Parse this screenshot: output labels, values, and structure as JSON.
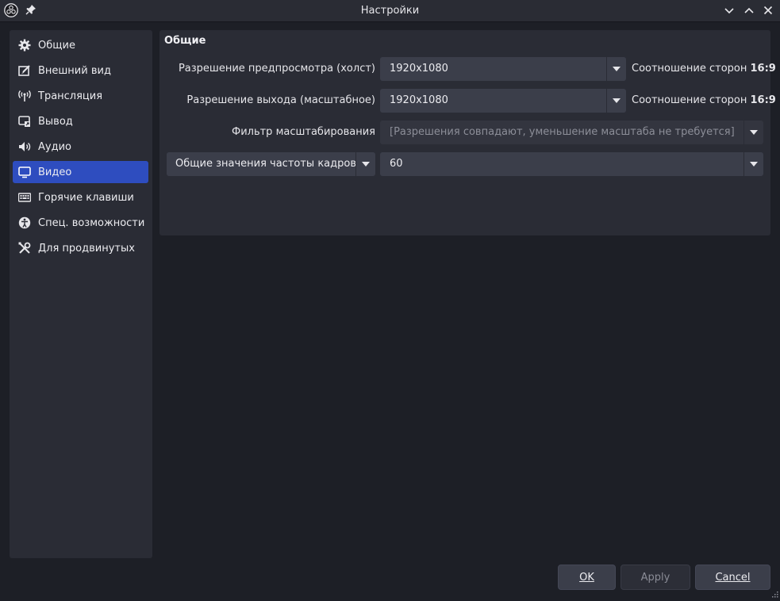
{
  "window": {
    "title": "Настройки"
  },
  "sidebar": {
    "items": [
      {
        "label": "Общие",
        "icon": "gear-icon"
      },
      {
        "label": "Внешний вид",
        "icon": "appearance-icon"
      },
      {
        "label": "Трансляция",
        "icon": "broadcast-icon"
      },
      {
        "label": "Вывод",
        "icon": "output-icon"
      },
      {
        "label": "Аудио",
        "icon": "audio-icon"
      },
      {
        "label": "Видео",
        "icon": "monitor-icon",
        "active": true
      },
      {
        "label": "Горячие клавиши",
        "icon": "keyboard-icon"
      },
      {
        "label": "Спец. возможности",
        "icon": "accessibility-icon"
      },
      {
        "label": "Для продвинутых",
        "icon": "tools-icon"
      }
    ]
  },
  "panel": {
    "section_title": "Общие",
    "base_resolution": {
      "label": "Разрешение предпросмотра (холст)",
      "value": "1920x1080",
      "aspect_prefix": "Соотношение сторон",
      "aspect_value": "16:9"
    },
    "output_resolution": {
      "label": "Разрешение выхода (масштабное)",
      "value": "1920x1080",
      "aspect_prefix": "Соотношение сторон",
      "aspect_value": "16:9"
    },
    "downscale_filter": {
      "label": "Фильтр масштабирования",
      "value": "[Разрешения совпадают, уменьшение масштаба не требуется]"
    },
    "fps": {
      "type_value": "Общие значения частоты кадров",
      "value": "60"
    }
  },
  "buttons": {
    "ok": "OK",
    "apply": "Apply",
    "cancel": "Cancel"
  },
  "colors": {
    "background": "#1d1f26",
    "panel": "#2a2c35",
    "active": "#2e4dbf",
    "control": "#3b3e4a"
  }
}
